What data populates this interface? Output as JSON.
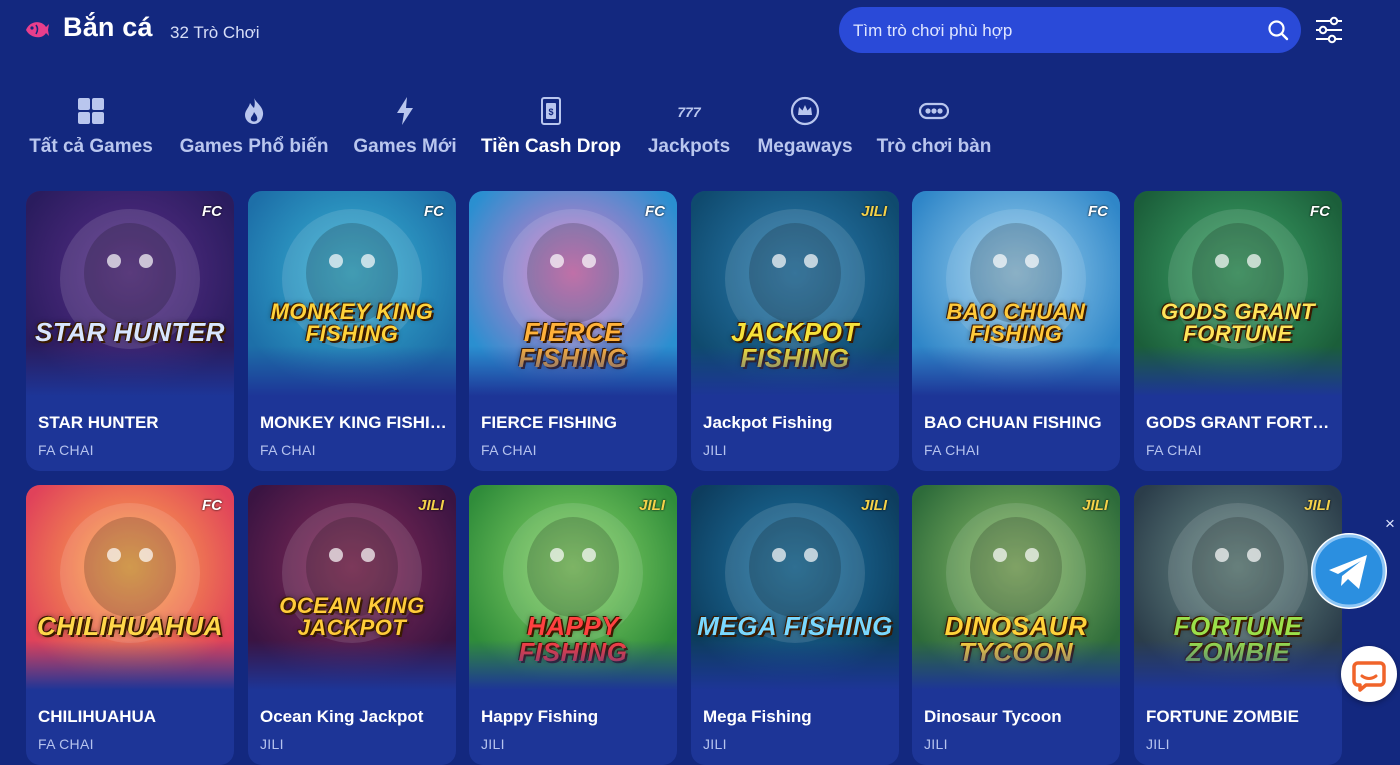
{
  "header": {
    "title": "Bắn cá",
    "count_label": "32 Trò Chơi",
    "search_placeholder": "Tìm trò chơi phù hợp",
    "accent_color": "#e83e8c"
  },
  "tabs": [
    {
      "label": "Tất cả Games",
      "icon": "grid-icon",
      "active": false
    },
    {
      "label": "Games Phổ biến",
      "icon": "flame-icon",
      "active": false
    },
    {
      "label": "Games Mới",
      "icon": "lightning-icon",
      "active": false
    },
    {
      "label": "Tiền Cash Drop",
      "icon": "cash-drop-icon",
      "active": true
    },
    {
      "label": "Jackpots",
      "icon": "777-icon",
      "active": false
    },
    {
      "label": "Megaways",
      "icon": "crown-icon",
      "active": false
    },
    {
      "label": "Trò chơi bàn",
      "icon": "table-game-icon",
      "active": false
    }
  ],
  "games": [
    {
      "title": "STAR HUNTER",
      "provider": "FA CHAI",
      "badge": "FC",
      "art_text": "STAR HUNTER",
      "bg1": "#2a1c5e",
      "bg2": "#5a2f8a",
      "text_color": "#d8e6ff"
    },
    {
      "title": "MONKEY KING FISHING",
      "provider": "FA CHAI",
      "badge": "FC",
      "art_text": "MONKEY KING FISHING",
      "bg1": "#1d6fa8",
      "bg2": "#39b6d6",
      "text_color": "#ffd23a"
    },
    {
      "title": "FIERCE FISHING",
      "provider": "FA CHAI",
      "badge": "FC",
      "art_text": "FIERCE FISHING",
      "bg1": "#2a8fd0",
      "bg2": "#e879c8",
      "text_color": "#ffb13a"
    },
    {
      "title": "Jackpot Fishing",
      "provider": "JILI",
      "badge": "JILI",
      "art_text": "Jackpot Fishing",
      "bg1": "#0f4a6e",
      "bg2": "#2b7fb3",
      "text_color": "#f6e23a"
    },
    {
      "title": "BAO CHUAN FISHING",
      "provider": "FA CHAI",
      "badge": "FC",
      "art_text": "BAO CHUAN FISHING",
      "bg1": "#2f86c8",
      "bg2": "#9fd3f0",
      "text_color": "#ffc93a"
    },
    {
      "title": "GODS GRANT FORTUNE",
      "provider": "FA CHAI",
      "badge": "FC",
      "art_text": "GODS GRANT FORTUNE",
      "bg1": "#1b5e3a",
      "bg2": "#3fa86a",
      "text_color": "#ffe45a"
    },
    {
      "title": "CHILIHUAHUA",
      "provider": "FA CHAI",
      "badge": "FC",
      "art_text": "CHILIHUAHUA",
      "bg1": "#e0425a",
      "bg2": "#ffb34a",
      "text_color": "#ffd84a"
    },
    {
      "title": "Ocean King Jackpot",
      "provider": "JILI",
      "badge": "JILI",
      "art_text": "OCEAN KING JACKPOT",
      "bg1": "#3a1442",
      "bg2": "#8a2d5a",
      "text_color": "#ffcc3a"
    },
    {
      "title": "Happy Fishing",
      "provider": "JILI",
      "badge": "JILI",
      "art_text": "Happy Fishing",
      "bg1": "#2f8c3a",
      "bg2": "#8cd86a",
      "text_color": "#ff4040"
    },
    {
      "title": "Mega Fishing",
      "provider": "JILI",
      "badge": "JILI",
      "art_text": "Mega Fishing",
      "bg1": "#0d3d5e",
      "bg2": "#1f78a8",
      "text_color": "#7ad8ff"
    },
    {
      "title": "Dinosaur Tycoon",
      "provider": "JILI",
      "badge": "JILI",
      "art_text": "Dinosaur Tycoon",
      "bg1": "#2d6b3a",
      "bg2": "#8fbf6a",
      "text_color": "#ffd23a"
    },
    {
      "title": "FORTUNE ZOMBIE",
      "provider": "JILI",
      "badge": "JILI",
      "art_text": "FORTUNE ZOMBIE",
      "bg1": "#2b3d4a",
      "bg2": "#6d8f8a",
      "text_color": "#9be04a"
    }
  ],
  "widgets": {
    "close_label": "×"
  }
}
